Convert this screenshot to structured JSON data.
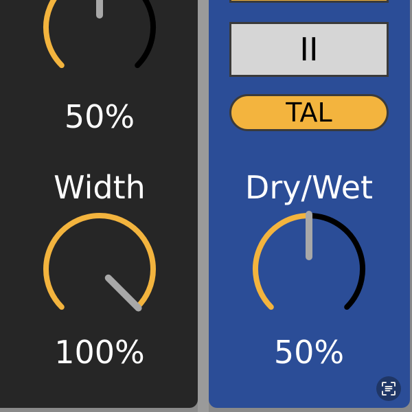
{
  "colors": {
    "accent": "#f3b43e",
    "left_panel": "#262626",
    "right_panel": "#2b4d97",
    "knob_track": "#000000",
    "knob_pointer": "#a8a8a8"
  },
  "knobs": [
    {
      "id": "top-knob",
      "label": "",
      "value_text": "50%",
      "value": 0.5
    },
    {
      "id": "width-knob",
      "label": "Width",
      "value_text": "100%",
      "value": 1.0
    },
    {
      "id": "drywet-knob",
      "label": "Dry/Wet",
      "value_text": "50%",
      "value": 0.5
    }
  ],
  "buttons": {
    "pause_label": "II",
    "tal_label": "TAL"
  },
  "icons": {
    "scan": "scan-text-icon"
  }
}
